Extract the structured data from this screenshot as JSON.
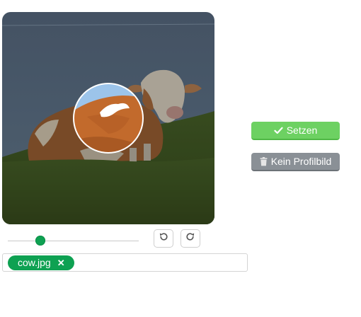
{
  "crop_editor": {
    "zoom_level": 0.25,
    "rotate_left_icon": "rotate-left-icon",
    "rotate_right_icon": "rotate-right-icon"
  },
  "file": {
    "name": "cow.jpg",
    "remove_label": "✕",
    "remove_icon": "close-icon"
  },
  "actions": {
    "set_label": "Setzen",
    "set_icon": "checkmark-icon",
    "none_label": "Kein Profilbild",
    "none_icon": "trash-icon"
  },
  "colors": {
    "accent_green": "#0ea152",
    "set_button": "#6dd162",
    "none_button": "#8a9096"
  }
}
